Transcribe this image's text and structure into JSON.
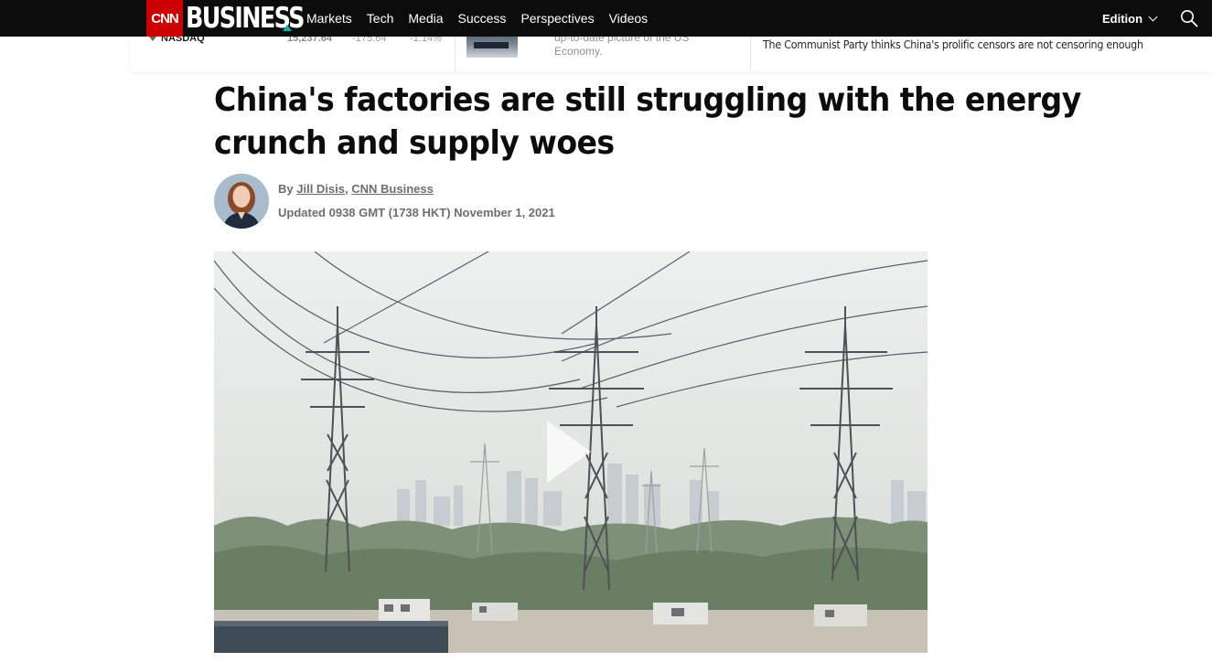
{
  "header": {
    "logo_cnn": "CNN",
    "logo_business": "BUSINESS",
    "nav": [
      "Markets",
      "Tech",
      "Media",
      "Success",
      "Perspectives",
      "Videos"
    ],
    "edition_label": "Edition",
    "icons": {
      "search": "search-icon",
      "edition": "chevron-down-icon"
    }
  },
  "market_strip": {
    "index_name": "NASDAQ",
    "index_value": "15,237.64",
    "index_change": "-175.64",
    "index_change_pct": "-1.14%",
    "promo_text": "up-to-date picture of the US Economy.",
    "headline": "The Communist Party thinks China's prolific censors are not censoring enough"
  },
  "article": {
    "title": "China's factories are still struggling with the energy crunch and supply woes",
    "byline_prefix": "By",
    "author": "Jill Disis",
    "byline_sep": ",",
    "source": "CNN Business",
    "updated": "Updated 0938 GMT (1738 HKT) November 1, 2021"
  },
  "video": {
    "icons": {
      "play": "play-icon"
    }
  },
  "colors": {
    "brand_red": "#cc0000",
    "topbar": "#0c0c0c",
    "accent_teal": "#0ab3a5"
  }
}
